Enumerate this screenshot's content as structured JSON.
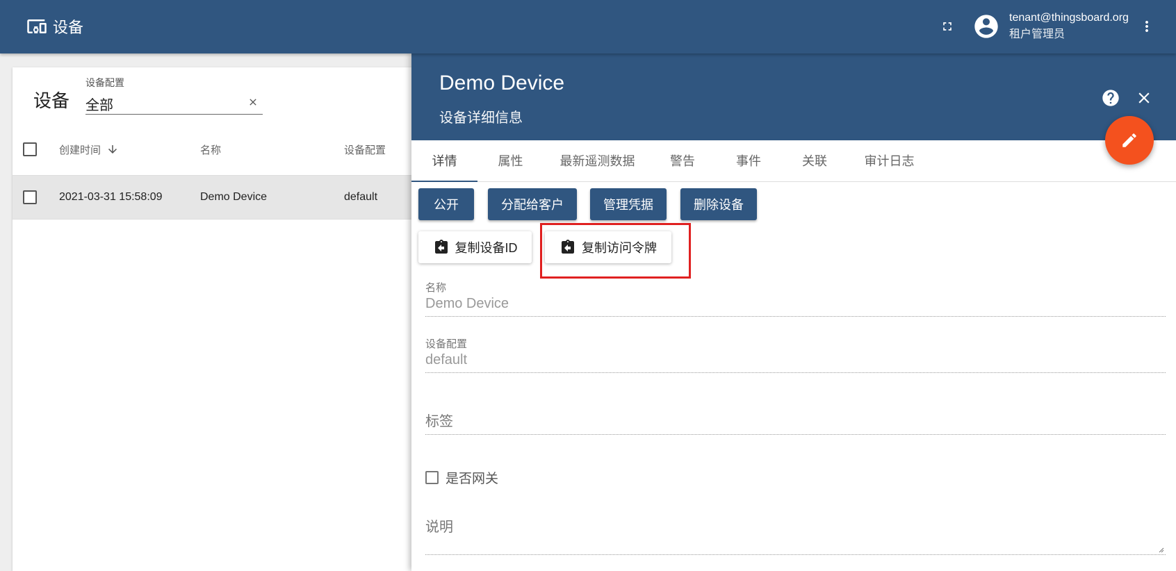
{
  "topbar": {
    "title": "设备",
    "user_email": "tenant@thingsboard.org",
    "user_role": "租户管理员"
  },
  "list": {
    "title": "设备",
    "filter_label": "设备配置",
    "filter_value": "全部",
    "columns": {
      "created_time": "创建时间",
      "name": "名称",
      "profile": "设备配置"
    },
    "rows": [
      {
        "created_time": "2021-03-31 15:58:09",
        "name": "Demo Device",
        "profile": "default"
      }
    ]
  },
  "detail": {
    "title": "Demo Device",
    "subtitle": "设备详细信息",
    "tabs": [
      "详情",
      "属性",
      "最新遥测数据",
      "警告",
      "事件",
      "关联",
      "审计日志"
    ],
    "active_tab": "详情",
    "actions": [
      "公开",
      "分配给客户",
      "管理凭据",
      "删除设备"
    ],
    "copy_buttons": [
      "复制设备ID",
      "复制访问令牌"
    ],
    "fields": {
      "name_label": "名称",
      "name_value": "Demo Device",
      "profile_label": "设备配置",
      "profile_value": "default",
      "label_placeholder": "标签",
      "gateway_label": "是否网关",
      "description_placeholder": "说明"
    }
  },
  "colors": {
    "primary": "#305680",
    "accent": "#f4511e",
    "highlight": "#e02020"
  }
}
